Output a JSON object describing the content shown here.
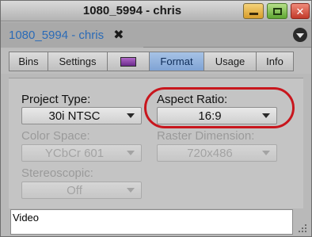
{
  "window": {
    "title": "1080_5994 - chris"
  },
  "tab": {
    "label": "1080_5994 - chris",
    "close_glyph": "✖"
  },
  "segments": [
    "Bins",
    "Settings",
    "",
    "Format",
    "Usage",
    "Info"
  ],
  "active_segment": "Format",
  "format": {
    "project_type": {
      "label": "Project Type:",
      "value": "30i NTSC",
      "enabled": true
    },
    "aspect_ratio": {
      "label": "Aspect Ratio:",
      "value": "16:9",
      "enabled": true
    },
    "color_space": {
      "label": "Color Space:",
      "value": "YCbCr 601",
      "enabled": false
    },
    "raster_dimension": {
      "label": "Raster Dimension:",
      "value": "720x486",
      "enabled": false
    },
    "stereoscopic": {
      "label": "Stereoscopic:",
      "value": "Off",
      "enabled": false
    }
  },
  "footer": {
    "text": "Video"
  },
  "colors": {
    "accent_blue": "#2b6bb7",
    "highlight_red": "#c8161d",
    "active_tab": "#7fa3d4"
  }
}
